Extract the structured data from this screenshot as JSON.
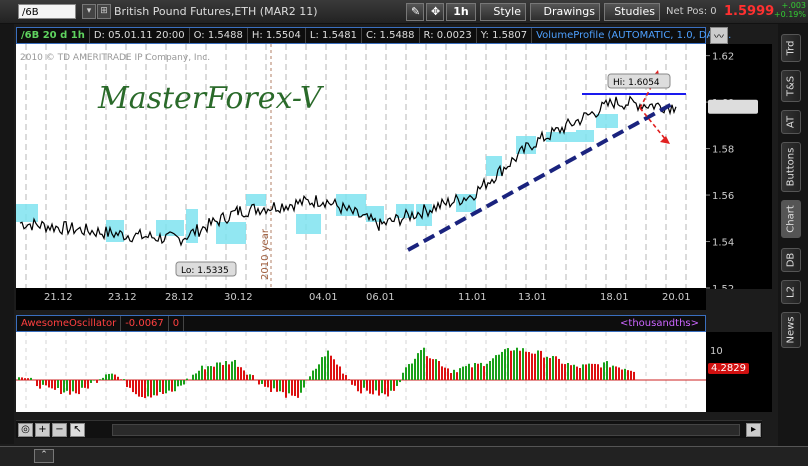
{
  "toolbar": {
    "symbol": "/6B",
    "title": "British Pound Futures,ETH (MAR2 11)",
    "timeframe_label": "1h",
    "style_label": "Style",
    "drawings_label": "Drawings",
    "studies_label": "Studies",
    "net_pos_label": "Net Pos: 0",
    "last_price": "1.5999",
    "change_abs": "+.003",
    "change_pct": "+0.19%"
  },
  "status": {
    "symbol_period": "/6B 20 d 1h",
    "date": "D: 05.01.11 20:00",
    "open": "O: 1.5488",
    "high": "H: 1.5504",
    "low": "L: 1.5481",
    "close": "C: 1.5488",
    "range": "R: 0.0023",
    "y": "Y: 1.5807",
    "study": "VolumeProfile (AUTOMATIC, 1.0, DAY,..."
  },
  "chart": {
    "copyright": "2010 © TD AMERITRADE IP Company, Inc.",
    "watermark": "MasterForex-V",
    "hi_label": "Hi: 1.6054",
    "lo_label": "Lo: 1.5335",
    "year_label": "2010 year",
    "y_ticks": [
      "1.62",
      "1.60",
      "1.58",
      "1.56",
      "1.54",
      "1.52"
    ],
    "x_ticks": [
      "21.12",
      "23.12",
      "28.12",
      "30.12",
      "04.01",
      "06.01",
      "11.01",
      "13.01",
      "18.01",
      "20.01"
    ]
  },
  "chart_data": [
    {
      "type": "line",
      "title": "British Pound Futures,ETH (MAR2 11)",
      "xlabel": "",
      "ylabel": "",
      "ylim": [
        1.52,
        1.625
      ],
      "grid": true,
      "x": [
        "21.12",
        "23.12",
        "28.12",
        "30.12",
        "04.01",
        "06.01",
        "11.01",
        "13.01",
        "18.01",
        "20.01"
      ],
      "series": [
        {
          "name": "/6B",
          "values": [
            1.548,
            1.543,
            1.541,
            1.553,
            1.558,
            1.547,
            1.56,
            1.582,
            1.6,
            1.598
          ]
        }
      ],
      "annotations": [
        "Hi: 1.6054",
        "Lo: 1.5335"
      ]
    },
    {
      "type": "bar",
      "title": "AwesomeOscillator",
      "ylabel": "",
      "ylim": [
        -10,
        15
      ],
      "current_value": 4.2829,
      "values": [
        2,
        -3,
        -4,
        3,
        -5,
        -4,
        4,
        6,
        -2,
        -6,
        9,
        -3,
        -5,
        10,
        3,
        5,
        10,
        8,
        4,
        5,
        3
      ]
    }
  ],
  "oscillator": {
    "name": "AwesomeOscillator",
    "value": "-0.0067",
    "zero": "0",
    "units": "<thousandths>",
    "axis_tick": "10",
    "current_label": "4.2829"
  },
  "side_tabs": [
    "Trd",
    "T&S",
    "AT",
    "Buttons",
    "Chart",
    "DB",
    "L2",
    "News"
  ],
  "colors": {
    "price_red": "#ff3030",
    "change_green": "#33cc33",
    "trend_line": "#1a237e",
    "profile": "#7fe3f0",
    "osc_up": "#1aa01a",
    "osc_down": "#dd1010"
  }
}
